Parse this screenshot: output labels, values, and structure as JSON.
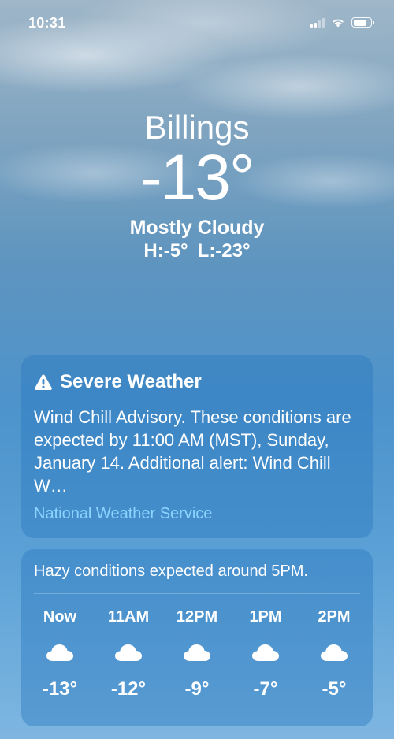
{
  "status_bar": {
    "time": "10:31",
    "icons": [
      "cellular-signal-icon",
      "wifi-icon",
      "battery-icon"
    ]
  },
  "header": {
    "city": "Billings",
    "temperature": "-13°",
    "condition": "Mostly Cloudy",
    "high": "H:-5°",
    "low": "L:-23°"
  },
  "alert": {
    "icon": "warning-triangle-icon",
    "title": "Severe Weather",
    "body": "Wind Chill Advisory. These conditions are expected by 11:00 AM (MST), Sunday, January 14. Additional alert: Wind Chill W…",
    "source": "National Weather Service",
    "source_color": "#8cd3ff"
  },
  "hourly": {
    "summary": "Hazy conditions expected around 5PM.",
    "hours": [
      {
        "label": "Now",
        "icon": "cloud-icon",
        "temp": "-13°"
      },
      {
        "label": "11AM",
        "icon": "cloud-icon",
        "temp": "-12°"
      },
      {
        "label": "12PM",
        "icon": "cloud-icon",
        "temp": "-9°"
      },
      {
        "label": "1PM",
        "icon": "cloud-icon",
        "temp": "-7°"
      },
      {
        "label": "2PM",
        "icon": "cloud-icon",
        "temp": "-5°"
      }
    ]
  }
}
